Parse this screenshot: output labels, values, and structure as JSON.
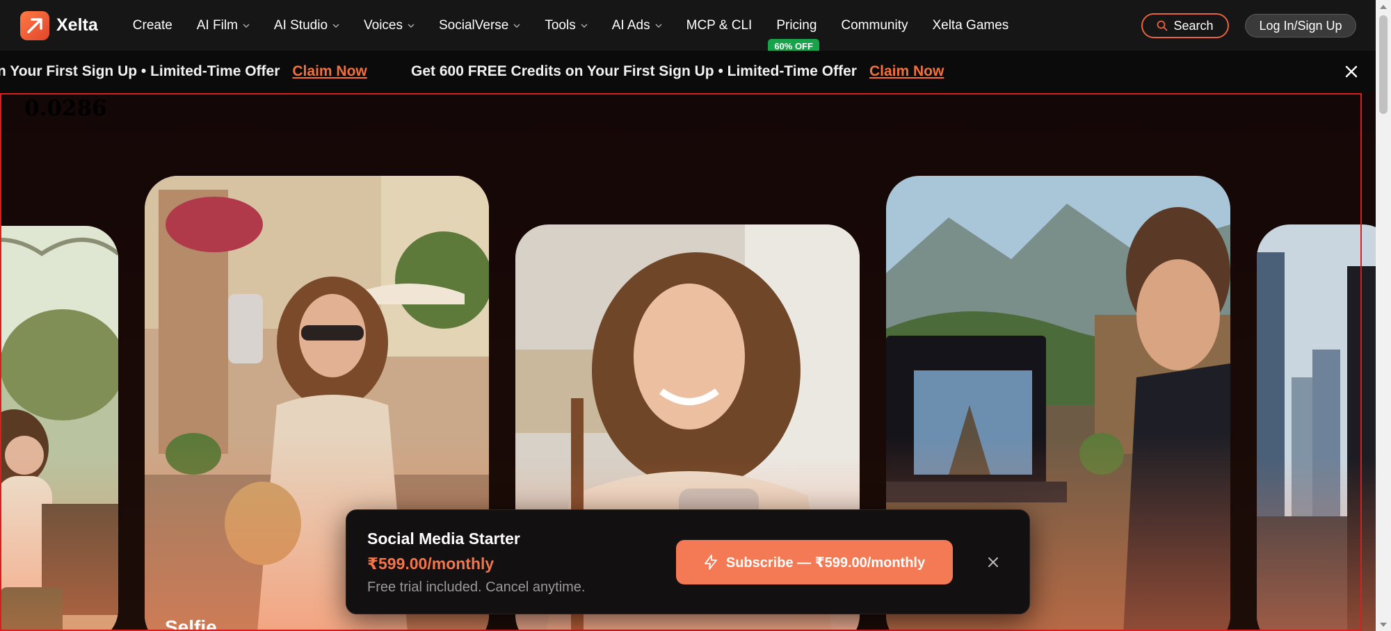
{
  "brand": {
    "name": "Xelta",
    "accent": "#e8633f"
  },
  "nav": {
    "items": [
      {
        "label": "Create",
        "dropdown": false
      },
      {
        "label": "AI Film",
        "dropdown": true
      },
      {
        "label": "AI Studio",
        "dropdown": true
      },
      {
        "label": "Voices",
        "dropdown": true
      },
      {
        "label": "SocialVerse",
        "dropdown": true
      },
      {
        "label": "Tools",
        "dropdown": true
      },
      {
        "label": "AI Ads",
        "dropdown": true
      },
      {
        "label": "MCP & CLI",
        "dropdown": false
      },
      {
        "label": "Pricing",
        "dropdown": false,
        "badge": "60% OFF"
      },
      {
        "label": "Community",
        "dropdown": false
      },
      {
        "label": "Xelta Games",
        "dropdown": false
      }
    ],
    "search_label": "Search",
    "login_label": "Log In/Sign Up"
  },
  "banner": {
    "partial_text": "n Your First Sign Up • Limited-Time Offer",
    "text": "Get 600 FREE Credits on Your First Sign Up • Limited-Time Offer",
    "cta": "Claim Now",
    "close_icon": "close-icon"
  },
  "hero": {
    "debug_value": "0.0286",
    "cards": [
      {
        "label": "",
        "scene": "cafe-woman"
      },
      {
        "label": "Selfie",
        "scene": "street-selfie"
      },
      {
        "label": "",
        "scene": "phone-smile"
      },
      {
        "label": "",
        "scene": "laptop-mountains"
      },
      {
        "label": "",
        "scene": "city-skyline"
      }
    ]
  },
  "popup": {
    "plan_name": "Social Media Starter",
    "price": "₹599.00/monthly",
    "note": "Free trial included. Cancel anytime.",
    "subscribe_label": "Subscribe — ₹599.00/monthly",
    "subscribe_icon": "lightning-icon",
    "close_icon": "close-icon"
  }
}
